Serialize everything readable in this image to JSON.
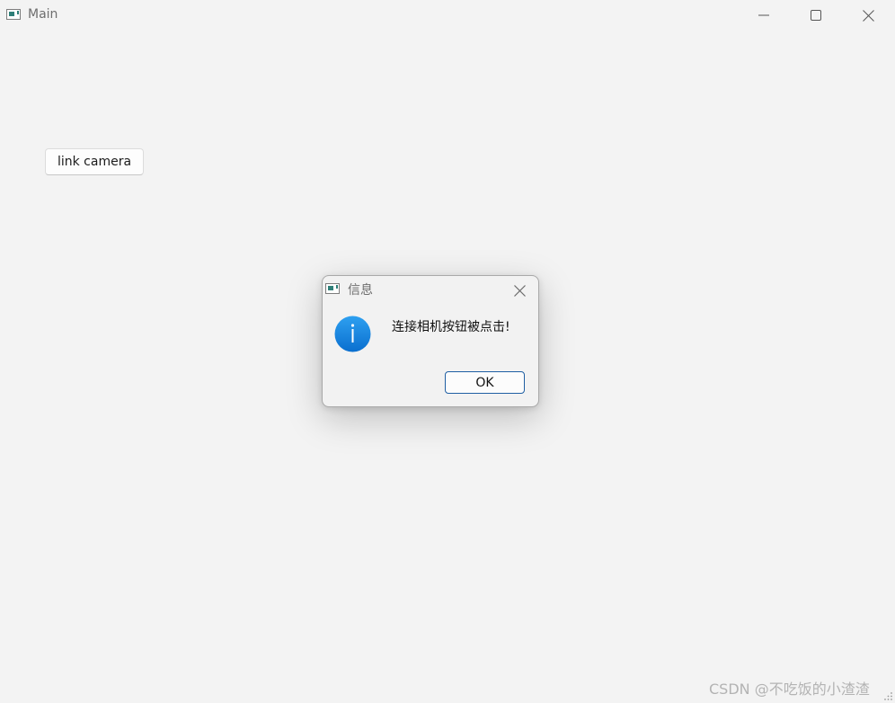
{
  "window": {
    "title": "Main",
    "icon": "app-window-icon",
    "controls": [
      "minimize-icon",
      "maximize-icon",
      "close-icon"
    ]
  },
  "main": {
    "link_button_label": "link camera"
  },
  "dialog": {
    "title": "信息",
    "icon": "info-icon",
    "message": "连接相机按钮被点击!",
    "ok_label": "OK"
  },
  "watermark": {
    "text": "CSDN @不吃饭的小渣渣"
  },
  "colors": {
    "background": "#f3f3f3",
    "accent": "#1f5fa3",
    "info_blue": "#1a8ae6"
  }
}
